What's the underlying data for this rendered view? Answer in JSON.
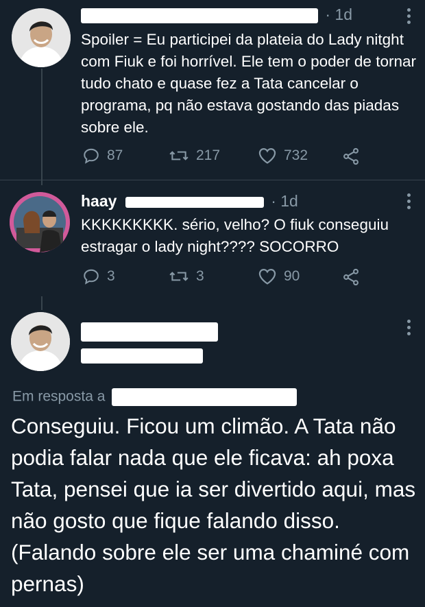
{
  "tweets": [
    {
      "time": "· 1d",
      "text": "Spoiler = Eu participei da plateia do Lady nitght com Fiuk e foi horrível. Ele tem o poder de tornar tudo chato e quase fez a Tata cancelar o programa, pq não estava gostando das piadas sobre ele.",
      "replies": "87",
      "retweets": "217",
      "likes": "732"
    },
    {
      "name_prefix": "haay",
      "time": "· 1d",
      "text": "KKKKKKKKK. sério, velho? O fiuk conseguiu estragar o lady night???? SOCORRO",
      "replies": "3",
      "retweets": "3",
      "likes": "90"
    }
  ],
  "main_tweet": {
    "reply_prefix": "Em resposta a",
    "text": "Conseguiu. Ficou um climão. A Tata não podia falar nada que ele ficava: ah poxa Tata, pensei que ia ser divertido aqui, mas não gosto que fique falando disso. (Falando sobre ele ser uma chaminé com pernas)"
  },
  "icons": [
    "reply-icon",
    "retweet-icon",
    "like-icon",
    "share-icon",
    "more-icon"
  ],
  "colors": {
    "background": "#15202b",
    "text": "#ffffff",
    "muted": "#8899a6",
    "link": "#1da1f2",
    "divider": "#38444d"
  }
}
